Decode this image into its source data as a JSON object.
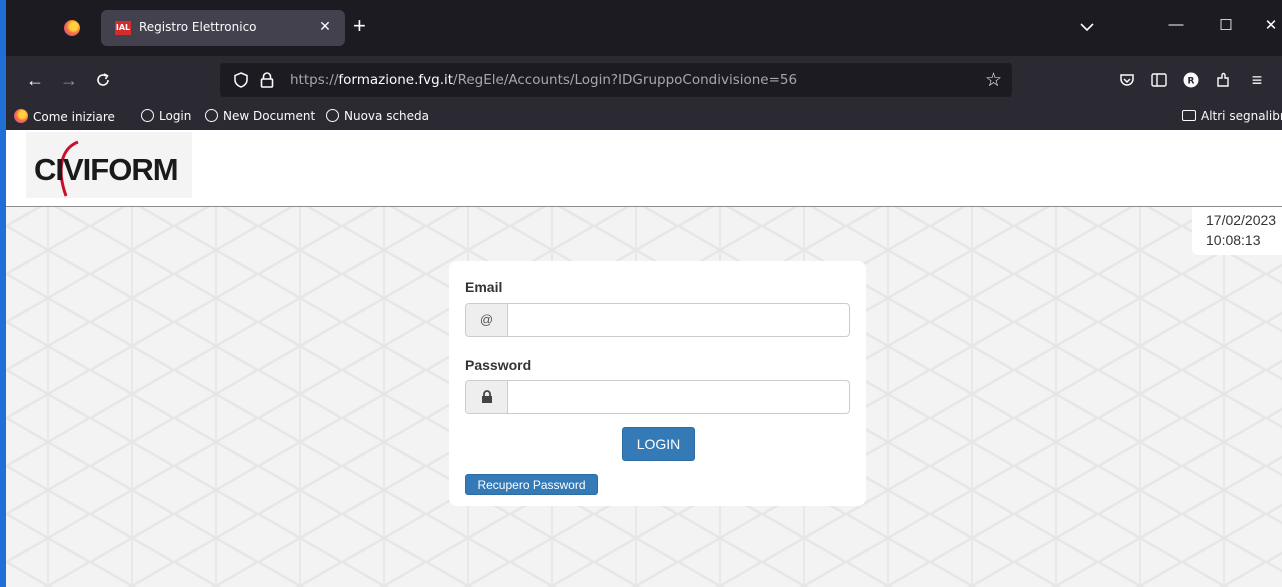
{
  "browser": {
    "tab": {
      "favicon_text": "IAL",
      "title": "Registro Elettronico"
    },
    "new_tab_symbol": "+",
    "url": {
      "prefix": "https://",
      "domain": "formazione.fvg.it",
      "path": "/RegEle/Accounts/Login?IDGruppoCondivisione=56"
    },
    "bookmarks": [
      "Come iniziare",
      "Login",
      "New Document",
      "Nuova scheda"
    ],
    "other_bookmarks": "Altri segnalibri",
    "accent_color": "#1e6fd6"
  },
  "header": {
    "logo_text": "CIVIFORM",
    "date": "17/02/2023",
    "time": "10:08:13"
  },
  "login": {
    "email_label": "Email",
    "email_addon": "@",
    "email_value": "",
    "password_label": "Password",
    "password_value": "",
    "login_button": "LOGIN",
    "recover_button": "Recupero Password",
    "button_color": "#337ab7"
  },
  "icons": [
    "firefox-icon",
    "tab-close-icon",
    "back-icon",
    "forward-icon",
    "reload-icon",
    "shield-icon",
    "lock-icon",
    "star-icon",
    "pocket-icon",
    "sidebar-icon",
    "profile-icon",
    "extensions-icon",
    "menu-icon",
    "globe-icon",
    "folder-icon",
    "padlock-icon"
  ]
}
